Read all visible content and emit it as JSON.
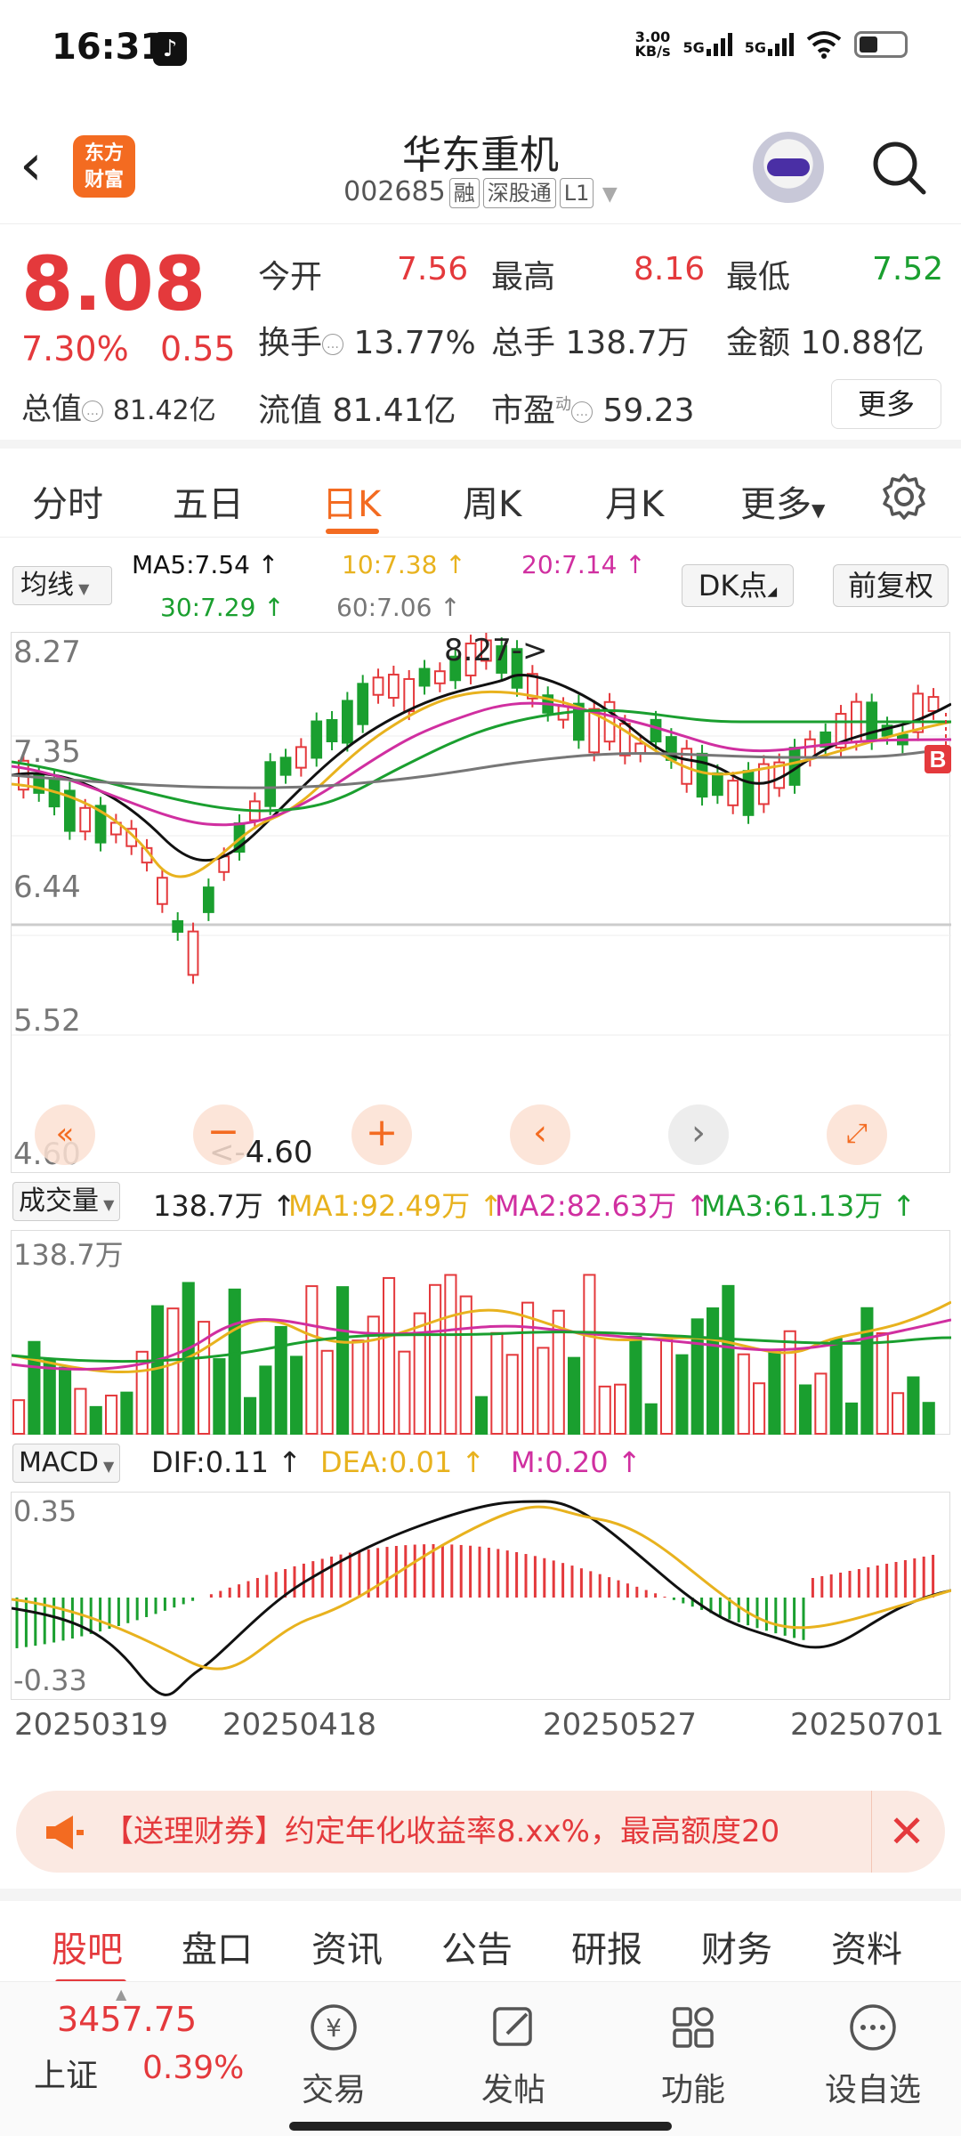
{
  "status": {
    "time": "16:31",
    "net_speed_top": "3.00",
    "net_speed_unit": "KB/s",
    "sig1": "5G",
    "sig2": "5G"
  },
  "header": {
    "title": "华东重机",
    "code": "002685",
    "tags": [
      "融",
      "深股通",
      "L1"
    ],
    "logo_text_top": "东方",
    "logo_text_bottom": "财富"
  },
  "quote": {
    "price": "8.08",
    "change_pct": "7.30%",
    "change_abs": "0.55",
    "open_label": "今开",
    "open": "7.56",
    "high_label": "最高",
    "high": "8.16",
    "low_label": "最低",
    "low": "7.52",
    "turnover_label": "换手",
    "turnover": "13.77%",
    "volume_label": "总手",
    "volume": "138.7万",
    "amount_label": "金额",
    "amount": "10.88亿",
    "mktcap_label": "总值",
    "mktcap": "81.42亿",
    "float_label": "流值",
    "float": "81.41亿",
    "pe_label": "市盈",
    "pe_sup": "动",
    "pe": "59.23",
    "more": "更多"
  },
  "tabs": [
    {
      "label": "分时"
    },
    {
      "label": "五日"
    },
    {
      "label": "日K"
    },
    {
      "label": "周K"
    },
    {
      "label": "月K"
    },
    {
      "label": "更多"
    }
  ],
  "ma": {
    "selector": "均线",
    "ma5": "MA5:7.54 ↑",
    "ma10": "10:7.38 ↑",
    "ma20": "20:7.14 ↑",
    "ma30": "30:7.29 ↑",
    "ma60": "60:7.06 ↑",
    "dk": "DK点",
    "fq": "前复权"
  },
  "kline": {
    "y_labels": [
      "8.27",
      "7.35",
      "6.44",
      "5.52",
      "4.60"
    ],
    "high_marker": "8.27->",
    "low_marker": "<-4.60",
    "b_marker": "B"
  },
  "volume": {
    "selector": "成交量",
    "value": "138.7万 ↑",
    "ma1": "MA1:92.49万 ↑",
    "ma2": "MA2:82.63万 ↑",
    "ma3": "MA3:61.13万 ↑",
    "y_label": "138.7万"
  },
  "macd": {
    "selector": "MACD",
    "dif": "DIF:0.11 ↑",
    "dea": "DEA:0.01 ↑",
    "m": "M:0.20 ↑",
    "y_top": "0.35",
    "y_bottom": "-0.33"
  },
  "dates": [
    "20250319",
    "20250418",
    "20250527",
    "20250701"
  ],
  "banner": {
    "text": "【送理财券】约定年化收益率8.xx%，最高额度20"
  },
  "subtabs": [
    {
      "label": "股吧"
    },
    {
      "label": "盘口"
    },
    {
      "label": "资讯"
    },
    {
      "label": "公告"
    },
    {
      "label": "研报"
    },
    {
      "label": "财务"
    },
    {
      "label": "资料"
    }
  ],
  "bottom": {
    "index_value": "3457.75",
    "index_name": "上证",
    "index_pct": "0.39%",
    "nav": [
      {
        "label": "交易"
      },
      {
        "label": "发帖"
      },
      {
        "label": "功能"
      },
      {
        "label": "设自选"
      }
    ]
  },
  "colors": {
    "up": "#e4393c",
    "down": "#1a9f2f",
    "accent": "#f36b21",
    "ma5": "#111111",
    "ma10": "#e8b21e",
    "ma20": "#d02fa0",
    "ma30": "#1a9f2f",
    "ma60": "#777777"
  }
}
